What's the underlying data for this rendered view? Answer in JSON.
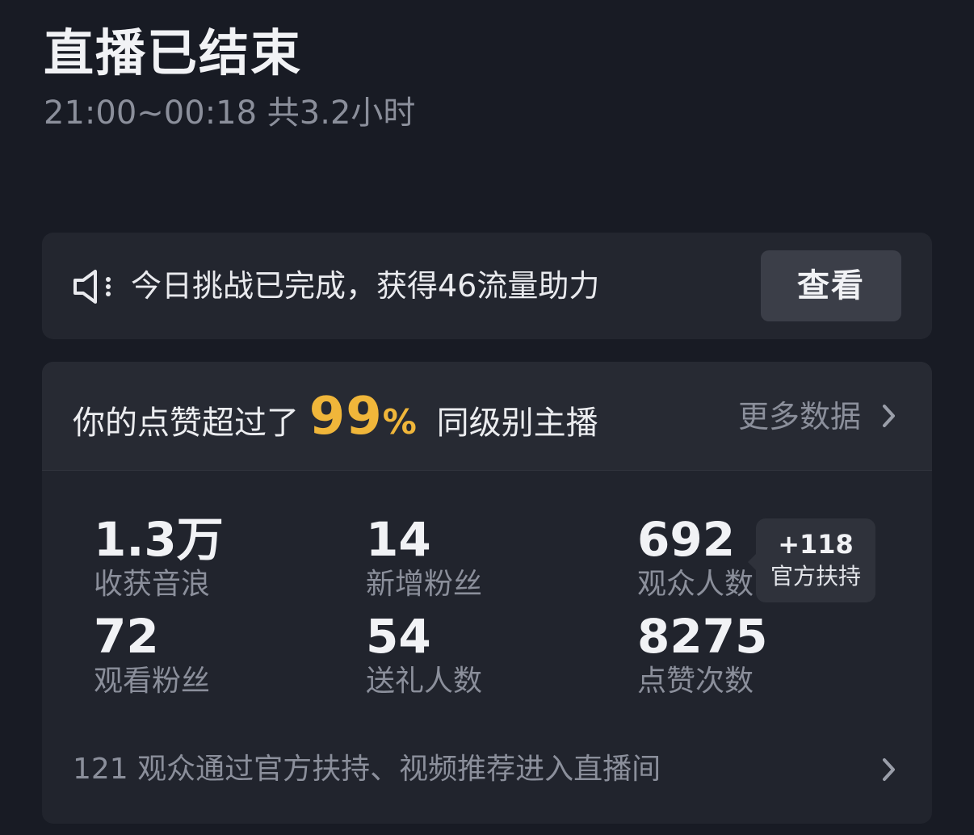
{
  "header": {
    "title": "直播已结束",
    "time_range": "21:00~00:18 共3.2小时"
  },
  "challenge": {
    "icon": "speaker-icon",
    "text": "今日挑战已完成，获得46流量助力",
    "button_label": "查看"
  },
  "likes_summary": {
    "prefix": "你的点赞超过了",
    "percent": "99",
    "percent_sign": "%",
    "suffix": "同级别主播",
    "more_label": "更多数据"
  },
  "stats": [
    {
      "value": "1.3万",
      "label": "收获音浪"
    },
    {
      "value": "14",
      "label": "新增粉丝"
    },
    {
      "value": "692",
      "label": "观众人数"
    },
    {
      "value": "72",
      "label": "观看粉丝"
    },
    {
      "value": "54",
      "label": "送礼人数"
    },
    {
      "value": "8275",
      "label": "点赞次数"
    }
  ],
  "official_support": {
    "count": "+118",
    "label": "官方扶持"
  },
  "footer": {
    "text": "121 观众通过官方扶持、视频推荐进入直播间"
  },
  "colors": {
    "background": "#181b24",
    "card": "#23262f",
    "highlight": "#f0b63a",
    "muted_text": "#8b8f9b"
  }
}
